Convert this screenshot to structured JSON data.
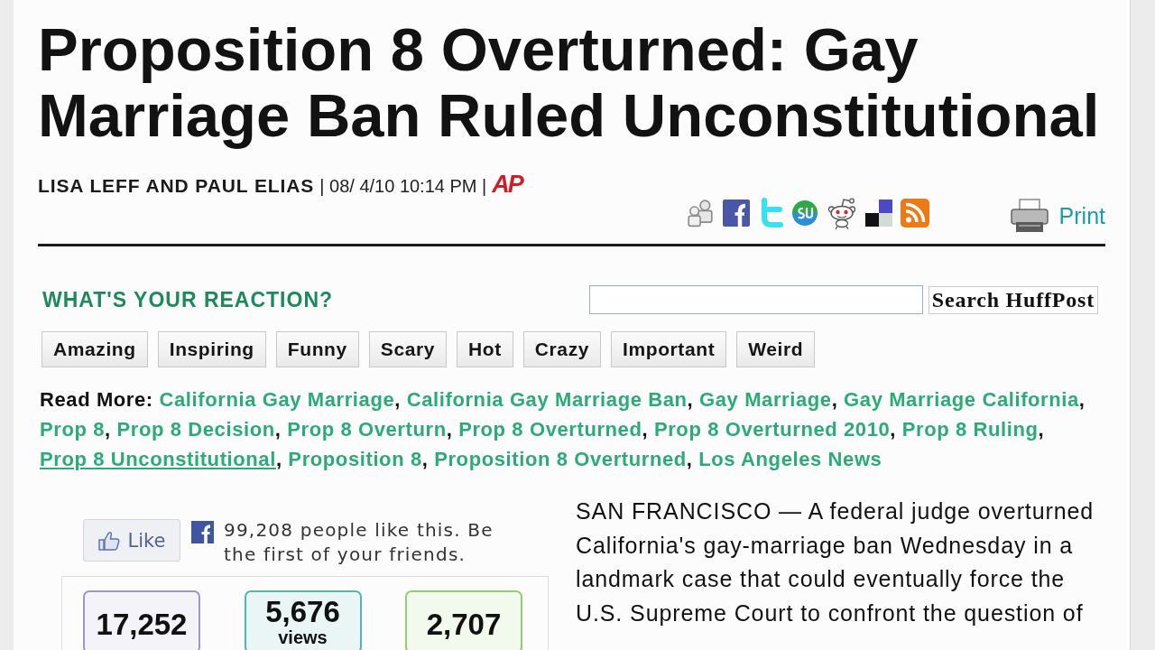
{
  "headline": "Proposition 8 Overturned: Gay Marriage Ban Ruled Unconstitutional",
  "byline": {
    "authors": "LISA LEFF AND PAUL ELIAS",
    "dateline": "| 08/ 4/10 10:14 PM |",
    "source": "AP"
  },
  "print_link": "Print",
  "reaction": {
    "heading": "WHAT'S YOUR REACTION?",
    "buttons": [
      "Amazing",
      "Inspiring",
      "Funny",
      "Scary",
      "Hot",
      "Crazy",
      "Important",
      "Weird"
    ]
  },
  "search": {
    "button": "Search HuffPost"
  },
  "read_more": {
    "label": "Read More:",
    "links": [
      {
        "text": "California Gay Marriage",
        "after": ",",
        "hovered": false
      },
      {
        "text": "California Gay Marriage Ban",
        "after": ",",
        "hovered": false
      },
      {
        "text": "Gay Marriage",
        "after": ",",
        "hovered": false
      },
      {
        "text": "Gay Marriage California",
        "after": ",",
        "hovered": false
      },
      {
        "text": "Prop 8",
        "after": ",",
        "hovered": false
      },
      {
        "text": "Prop 8 Decision",
        "after": ",",
        "hovered": false
      },
      {
        "text": "Prop 8 Overturn",
        "after": ",",
        "hovered": false
      },
      {
        "text": "Prop 8 Overturned",
        "after": ",",
        "hovered": false
      },
      {
        "text": "Prop 8 Overturned 2010",
        "after": ",",
        "hovered": false
      },
      {
        "text": "Prop 8 Ruling",
        "after": ",",
        "hovered": false
      },
      {
        "text": "Prop 8 Unconstitutional",
        "after": ",",
        "hovered": true
      },
      {
        "text": "Proposition 8",
        "after": ",",
        "hovered": false
      },
      {
        "text": "Proposition 8 Overturned",
        "after": ",",
        "hovered": false
      },
      {
        "text": "Los Angeles News",
        "hovered": false
      }
    ]
  },
  "like_widget": {
    "button": "Like",
    "text": "99,208 people like this. Be the first of your friends."
  },
  "stats": [
    {
      "count": "17,252",
      "color": "#9b98c9"
    },
    {
      "count": "5,676",
      "label": "views",
      "color": "#4cb8b0"
    },
    {
      "count": "2,707",
      "color": "#8fd06c"
    }
  ],
  "article": {
    "text": "SAN FRANCISCO — A federal judge overturned California's gay-marriage ban Wednesday in a landmark case that could eventually force the U.S. Supreme Court to confront the question of"
  }
}
